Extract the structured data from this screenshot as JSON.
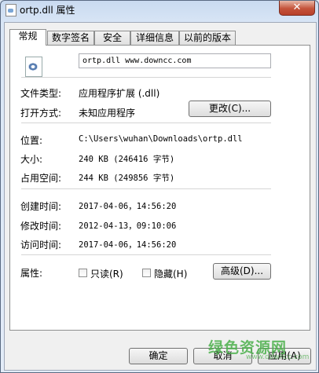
{
  "window": {
    "title": "ortp.dll 属性",
    "close_symbol": "✕"
  },
  "tabs": [
    "常规",
    "数字签名",
    "安全",
    "详细信息",
    "以前的版本"
  ],
  "general": {
    "file_name": "ortp.dll  www.downcc.com",
    "type_label": "文件类型:",
    "type_value": "应用程序扩展 (.dll)",
    "open_label": "打开方式:",
    "open_value": "未知应用程序",
    "change_button": "更改(C)...",
    "location_label": "位置:",
    "location_value": "C:\\Users\\wuhan\\Downloads\\ortp.dll",
    "size_label": "大小:",
    "size_value": "240 KB (246416 字节)",
    "disk_label": "占用空间:",
    "disk_value": "244 KB (249856 字节)",
    "created_label": "创建时间:",
    "created_value": "2017-04-06，14:56:20",
    "modified_label": "修改时间:",
    "modified_value": "2012-04-13，09:10:06",
    "accessed_label": "访问时间:",
    "accessed_value": "2017-04-06，14:56:20",
    "attributes_label": "属性:",
    "readonly_label": "只读(R)",
    "readonly_checked": false,
    "hidden_label": "隐藏(H)",
    "hidden_checked": false,
    "advanced_button": "高级(D)..."
  },
  "footer": {
    "ok": "确定",
    "cancel": "取消",
    "apply": "应用(A)"
  },
  "watermark": {
    "text": "绿色资源网",
    "url": "www.downcc.com"
  },
  "colors": {
    "title_gradient": "#c9daf0",
    "close_red": "#c4533a",
    "watermark_green": "#4bb04b"
  }
}
